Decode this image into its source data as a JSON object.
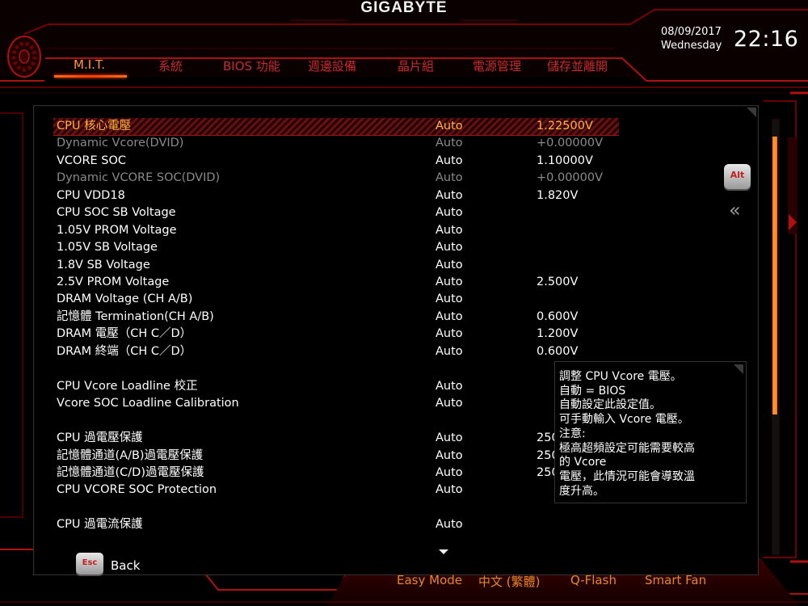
{
  "brand": "GIGABYTE",
  "datetime": {
    "date": "08/09/2017",
    "weekday": "Wednesday",
    "time": "22:16"
  },
  "tabs": [
    {
      "label": "M.I.T.",
      "active": true
    },
    {
      "label": "系統"
    },
    {
      "label": "BIOS 功能"
    },
    {
      "label": "週邊設備"
    },
    {
      "label": "晶片組"
    },
    {
      "label": "電源管理"
    },
    {
      "label": "儲存並離開"
    }
  ],
  "settings": [
    {
      "name": "CPU 核心電壓",
      "mode": "Auto",
      "value": "1.22500V",
      "state": "selected"
    },
    {
      "name": "Dynamic Vcore(DVID)",
      "mode": "Auto",
      "value": "+0.00000V",
      "state": "dim"
    },
    {
      "name": "VCORE SOC",
      "mode": "Auto",
      "value": "1.10000V"
    },
    {
      "name": "Dynamic VCORE SOC(DVID)",
      "mode": "Auto",
      "value": "+0.00000V",
      "state": "dim"
    },
    {
      "name": "CPU VDD18",
      "mode": "Auto",
      "value": "1.820V"
    },
    {
      "name": "CPU SOC SB Voltage",
      "mode": "Auto",
      "value": ""
    },
    {
      "name": "1.05V PROM Voltage",
      "mode": "Auto",
      "value": ""
    },
    {
      "name": "1.05V SB Voltage",
      "mode": "Auto",
      "value": ""
    },
    {
      "name": "1.8V SB Voltage",
      "mode": "Auto",
      "value": ""
    },
    {
      "name": "2.5V PROM Voltage",
      "mode": "Auto",
      "value": "2.500V"
    },
    {
      "name": "DRAM Voltage     (CH A/B)",
      "mode": "Auto",
      "value": ""
    },
    {
      "name": "記憶體 Termination(CH A/B)",
      "mode": "Auto",
      "value": "0.600V"
    },
    {
      "name": "DRAM 電壓（CH C／D）",
      "mode": "Auto",
      "value": "1.200V"
    },
    {
      "name": "DRAM 終端（CH C／D）",
      "mode": "Auto",
      "value": "0.600V"
    },
    {
      "name": "CPU Vcore Loadline 校正",
      "mode": "Auto",
      "value": ""
    },
    {
      "name": "Vcore SOC Loadline Calibration",
      "mode": "Auto",
      "value": ""
    },
    {
      "name": "CPU 過電壓保護",
      "mode": "Auto",
      "value": "250"
    },
    {
      "name": "記憶體通道(A/B)過電壓保護",
      "mode": "Auto",
      "value": "250"
    },
    {
      "name": "記憶體通道(C/D)過電壓保護",
      "mode": "Auto",
      "value": "250"
    },
    {
      "name": "CPU VCORE SOC Protection",
      "mode": "Auto",
      "value": ""
    },
    {
      "name": "CPU 過電流保護",
      "mode": "Auto",
      "value": ""
    }
  ],
  "help": [
    "調整 CPU Vcore 電壓。",
    "自動 = BIOS",
    "自動設定此設定值。",
    "可手動輸入 Vcore 電壓。",
    "注意:",
    "極高超頻設定可能需要較高",
    "的 Vcore",
    "電壓，此情況可能會導致溫",
    "度升高。"
  ],
  "keys": {
    "alt": "Alt",
    "esc": "Esc",
    "back": "Back"
  },
  "bottom_buttons": [
    "Easy Mode",
    "中文 (繁體)",
    "Q-Flash",
    "Smart Fan"
  ],
  "colors": {
    "accent_red": "#c92c2c",
    "active_orange": "#ff9b3b",
    "selected_text": "#ffb23f",
    "scrollbar": "#ff7a1a"
  },
  "scroll_position": {
    "thumb_start": 0.04,
    "thumb_size": 0.64
  }
}
